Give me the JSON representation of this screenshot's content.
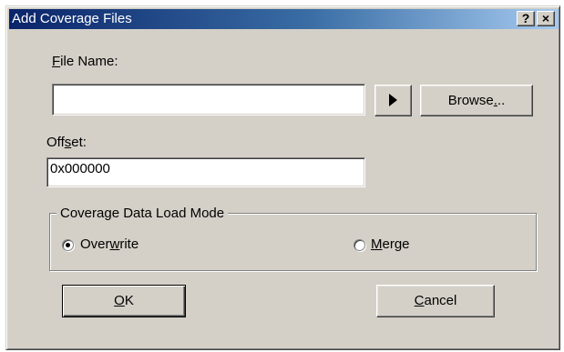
{
  "window": {
    "title": "Add Coverage Files",
    "help_button": "?",
    "close_button": "×"
  },
  "file_name": {
    "label_prefix": "",
    "label_access_key": "F",
    "label_rest": "ile Name:",
    "value": ""
  },
  "arrow_button": {
    "icon": "play-arrow-icon"
  },
  "browse_button": {
    "label_prefix": "Browse",
    "label_access_key": ".",
    "label_rest": ".."
  },
  "offset": {
    "label_prefix": "Off",
    "label_access_key": "s",
    "label_rest": "et:",
    "value": "0x000000"
  },
  "load_mode": {
    "legend": "Coverage Data Load Mode",
    "overwrite": {
      "label_prefix": "Over",
      "label_access_key": "w",
      "label_rest": "rite",
      "selected": true
    },
    "merge": {
      "label_prefix": "",
      "label_access_key": "M",
      "label_rest": "erge",
      "selected": false
    }
  },
  "ok_button": {
    "label_prefix": "",
    "label_access_key": "O",
    "label_rest": "K"
  },
  "cancel_button": {
    "label_prefix": "",
    "label_access_key": "C",
    "label_rest": "ancel"
  }
}
